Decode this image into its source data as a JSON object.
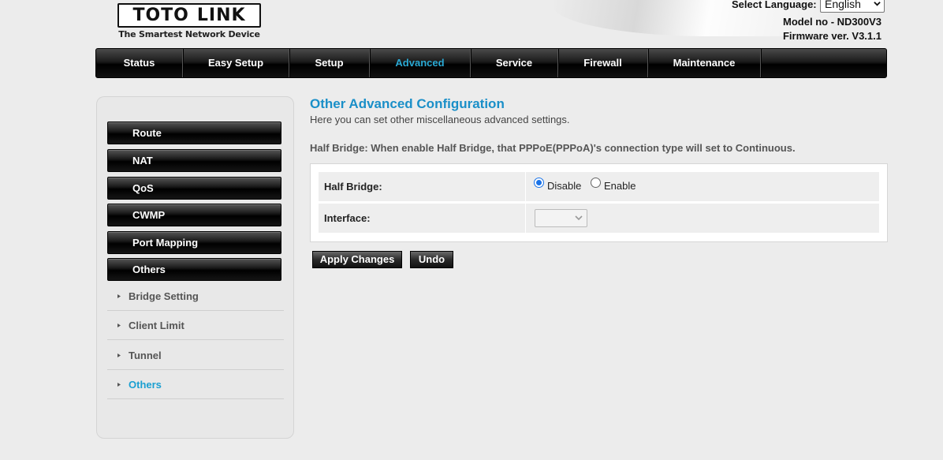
{
  "header": {
    "logo_text_left": "TOTO",
    "logo_text_right": "LINK",
    "tagline": "The Smartest Network Device",
    "language_label": "Select Language:",
    "language_value": "English",
    "model": "Model no - ND300V3",
    "firmware": "Firmware ver. V3.1.1"
  },
  "nav": {
    "items": [
      {
        "label": "Status",
        "active": false
      },
      {
        "label": "Easy Setup",
        "active": false
      },
      {
        "label": "Setup",
        "active": false
      },
      {
        "label": "Advanced",
        "active": true
      },
      {
        "label": "Service",
        "active": false
      },
      {
        "label": "Firewall",
        "active": false
      },
      {
        "label": "Maintenance",
        "active": false
      }
    ]
  },
  "sidebar": {
    "menu": [
      "Route",
      "NAT",
      "QoS",
      "CWMP",
      "Port Mapping",
      "Others"
    ],
    "submenu": [
      {
        "label": "Bridge Setting",
        "active": false
      },
      {
        "label": "Client Limit",
        "active": false
      },
      {
        "label": "Tunnel",
        "active": false
      },
      {
        "label": "Others",
        "active": true
      }
    ]
  },
  "main": {
    "title": "Other Advanced Configuration",
    "description": "Here you can set other miscellaneous advanced settings.",
    "note": "Half Bridge: When enable Half Bridge, that PPPoE(PPPoA)'s connection type will set to Continuous.",
    "half_bridge_label": "Half Bridge:",
    "disable_label": "Disable",
    "enable_label": "Enable",
    "half_bridge_value": "Disable",
    "interface_label": "Interface:",
    "interface_value": ""
  },
  "buttons": {
    "apply": "Apply Changes",
    "undo": "Undo"
  },
  "colors": {
    "accent": "#1a8fc8",
    "nav_active": "#2aa9d4",
    "background": "#ececec"
  }
}
